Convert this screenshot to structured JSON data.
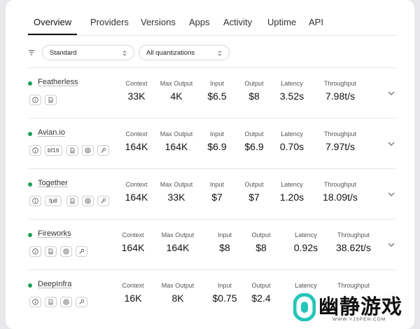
{
  "tabs": [
    {
      "label": "Overview",
      "active": true
    },
    {
      "label": "Providers",
      "active": false
    },
    {
      "label": "Versions",
      "active": false
    },
    {
      "label": "Apps",
      "active": false
    },
    {
      "label": "Activity",
      "active": false
    },
    {
      "label": "Uptime",
      "active": false
    },
    {
      "label": "API",
      "active": false
    }
  ],
  "filters": {
    "icon": "filter-icon",
    "sort_select": "Standard",
    "quantization_select": "All quantizations"
  },
  "metric_labels": {
    "context": "Context",
    "max_output": "Max Output",
    "input": "Input",
    "output": "Output",
    "latency": "Latency",
    "throughput": "Throughput"
  },
  "providers": [
    {
      "name": "Featherless",
      "status_color": "#1e9f5a",
      "badges": [
        {
          "icon": "info-icon"
        },
        {
          "icon": "document-icon"
        }
      ],
      "context": "33K",
      "max_output": "4K",
      "input": "$6.5",
      "output": "$8",
      "latency": "3.52s",
      "throughput": "7.98t/s"
    },
    {
      "name": "Avian.io",
      "status_color": "#1e9f5a",
      "badges": [
        {
          "icon": "info-icon"
        },
        {
          "text": "bf16"
        },
        {
          "icon": "document-icon"
        },
        {
          "icon": "settings-icon"
        },
        {
          "icon": "wrench-icon"
        }
      ],
      "context": "164K",
      "max_output": "164K",
      "input": "$6.9",
      "output": "$6.9",
      "latency": "0.70s",
      "throughput": "7.97t/s"
    },
    {
      "name": "Together",
      "status_color": "#1e9f5a",
      "badges": [
        {
          "icon": "info-icon"
        },
        {
          "text": "fp8"
        },
        {
          "icon": "document-icon"
        },
        {
          "icon": "settings-icon"
        },
        {
          "icon": "wrench-icon"
        }
      ],
      "context": "164K",
      "max_output": "33K",
      "input": "$7",
      "output": "$7",
      "latency": "1.20s",
      "throughput": "18.09t/s"
    },
    {
      "name": "Fireworks",
      "status_color": "#1e9f5a",
      "badges": [
        {
          "icon": "info-icon"
        },
        {
          "icon": "document-icon"
        },
        {
          "icon": "settings-icon"
        },
        {
          "icon": "wrench-icon"
        }
      ],
      "context": "164K",
      "max_output": "164K",
      "input": "$8",
      "output": "$8",
      "latency": "0.92s",
      "throughput": "38.62t/s"
    },
    {
      "name": "DeepInfra",
      "status_color": "#1e9f5a",
      "badges": [
        {
          "icon": "info-icon"
        },
        {
          "icon": "document-icon"
        },
        {
          "icon": "settings-icon"
        },
        {
          "icon": "wrench-icon"
        }
      ],
      "context": "16K",
      "max_output": "8K",
      "input": "$0.75",
      "output": "$2.4",
      "latency": "",
      "throughput": ""
    }
  ],
  "watermark": {
    "text": "幽静游戏",
    "url": "WWW.YJSPEN.COM",
    "logo_color": "#23c6b8"
  }
}
